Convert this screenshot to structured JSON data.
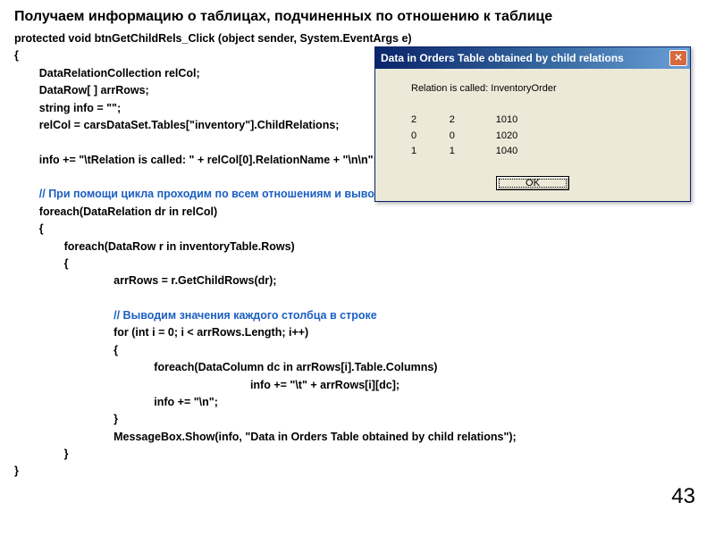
{
  "title": "Получаем информацию о таблицах, подчиненных по отношению к таблице",
  "code": {
    "l1": "protected void btnGetChildRels_Click (object sender, System.EventArgs e)",
    "l2": "{",
    "l3": "        DataRelationCollection relCol;",
    "l4": "        DataRow[ ] arrRows;",
    "l5": "        string info = \"\";",
    "l6": "        relCol = carsDataSet.Tables[\"inventory\"].ChildRelations;",
    "l7": "",
    "l8": "        info += \"\\tRelation is called: \" + relCol[0].RelationName + \"\\n\\n\";",
    "l9": "",
    "c1": "        // При помощи цикла проходим по всем отношениям и выводим о них  информацию:",
    "l10": "        foreach(DataRelation dr in relCol)",
    "l11": "        {",
    "l12": "                foreach(DataRow r in inventoryTable.Rows)",
    "l13": "                {",
    "l14": "                                arrRows = r.GetChildRows(dr);",
    "l15": "",
    "c2": "                                // Выводим значения каждого столбца в строке",
    "l16": "                                for (int i = 0; i < arrRows.Length; i++)",
    "l17": "                                {",
    "l18": "                                             foreach(DataColumn dc in arrRows[i].Table.Columns)",
    "l19": "                                                                            info += \"\\t\" + arrRows[i][dc];",
    "l20": "                                             info += \"\\n\";",
    "l21": "                                }",
    "l22": "                                MessageBox.Show(info, \"Data in Orders Table obtained by child relations\");",
    "l23": "                }",
    "l24": "}"
  },
  "dialog": {
    "title": "Data in Orders Table obtained by child relations",
    "body_line1": "Relation is called: InventoryOrder",
    "row1": "2            2               1010",
    "row2": "0            0               1020",
    "row3": "1            1               1040",
    "ok": "OK",
    "close": "✕"
  },
  "page_number": "43"
}
